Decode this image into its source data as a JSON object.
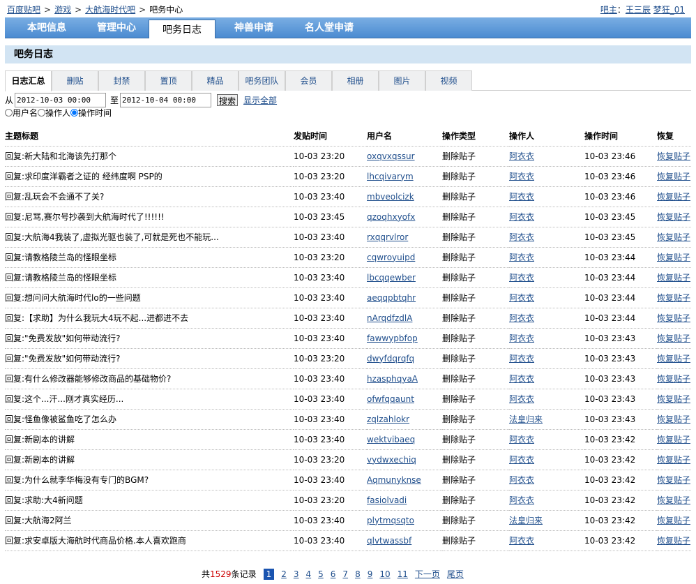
{
  "breadcrumb": [
    "百度贴吧",
    "游戏",
    "大航海时代吧"
  ],
  "breadcrumb_current": "吧务中心",
  "breadcrumb_sep": ">",
  "owner": {
    "label": "吧主",
    "sep": "：",
    "names": [
      "王三辰",
      "梦狂_01"
    ]
  },
  "nav": {
    "tabs": [
      "本吧信息",
      "管理中心",
      "吧务日志",
      "神兽申请",
      "名人堂申请"
    ],
    "active": 2
  },
  "section_title": "吧务日志",
  "subtabs": {
    "items": [
      "日志汇总",
      "删贴",
      "封禁",
      "置顶",
      "精品",
      "吧务团队",
      "会员",
      "相册",
      "图片",
      "视频"
    ],
    "active": 0
  },
  "filter": {
    "from_label": "从",
    "from_value": "2012-10-03 00:00",
    "to_label": "至",
    "to_value": "2012-10-04 00:00",
    "search_label": "搜索",
    "show_all": "显示全部"
  },
  "radios": {
    "options": [
      "用户名",
      "操作人",
      "操作时间"
    ],
    "selected": 2
  },
  "table": {
    "headers": [
      "主题标题",
      "发贴时间",
      "用户名",
      "操作类型",
      "操作人",
      "操作时间",
      "恢复"
    ],
    "rows": [
      [
        "回复:新大陆和北海该先打那个",
        "10-03 23:20",
        "oxqvxqssur",
        "删除贴子",
        "阿衣衣",
        "10-03 23:46",
        "恢复贴子"
      ],
      [
        "回复:求印度洋霸者之证的 经纬度啊 PSP的",
        "10-03 23:20",
        "lhcqivarym",
        "删除贴子",
        "阿衣衣",
        "10-03 23:46",
        "恢复贴子"
      ],
      [
        "回复:乱玩会不会通不了关?",
        "10-03 23:40",
        "mbveolcizk",
        "删除贴子",
        "阿衣衣",
        "10-03 23:46",
        "恢复贴子"
      ],
      [
        "回复:尼骂,赛尔号抄袭到大航海时代了!!!!!!",
        "10-03 23:45",
        "qzoqhxyofx",
        "删除贴子",
        "阿衣衣",
        "10-03 23:45",
        "恢复贴子"
      ],
      [
        "回复:大航海4我装了,虚拟光驱也装了,可就是死也不能玩...",
        "10-03 23:40",
        "rxqqrvlror",
        "删除贴子",
        "阿衣衣",
        "10-03 23:45",
        "恢复贴子"
      ],
      [
        "回复:请教格陵兰岛的怪眼坐标",
        "10-03 23:20",
        "cqwroyuipd",
        "删除贴子",
        "阿衣衣",
        "10-03 23:44",
        "恢复贴子"
      ],
      [
        "回复:请教格陵兰岛的怪眼坐标",
        "10-03 23:40",
        "lbcqqewber",
        "删除贴子",
        "阿衣衣",
        "10-03 23:44",
        "恢复贴子"
      ],
      [
        "回复:想问问大航海时代lo的一些问题",
        "10-03 23:40",
        "aeqqpbtqhr",
        "删除贴子",
        "阿衣衣",
        "10-03 23:44",
        "恢复贴子"
      ],
      [
        "回复:【求助】为什么我玩大4玩不起...进都进不去",
        "10-03 23:40",
        "nArqdfzdlA",
        "删除贴子",
        "阿衣衣",
        "10-03 23:44",
        "恢复贴子"
      ],
      [
        "回复:\"免费发放\"如何带动流行?",
        "10-03 23:40",
        "fawwypbfop",
        "删除贴子",
        "阿衣衣",
        "10-03 23:43",
        "恢复贴子"
      ],
      [
        "回复:\"免费发放\"如何带动流行?",
        "10-03 23:20",
        "dwyfdqrqfq",
        "删除贴子",
        "阿衣衣",
        "10-03 23:43",
        "恢复贴子"
      ],
      [
        "回复:有什么修改器能够修改商品的基础物价?",
        "10-03 23:40",
        "hzasphqyaA",
        "删除贴子",
        "阿衣衣",
        "10-03 23:43",
        "恢复贴子"
      ],
      [
        "回复:这个...汗...刚才真实经历...",
        "10-03 23:40",
        "ofwfqqaunt",
        "删除贴子",
        "阿衣衣",
        "10-03 23:43",
        "恢复贴子"
      ],
      [
        "回复:怪鱼像被鲨鱼吃了怎么办",
        "10-03 23:40",
        "zqlzahlokr",
        "删除贴子",
        "法皇归来",
        "10-03 23:43",
        "恢复贴子"
      ],
      [
        "回复:新剧本的讲解",
        "10-03 23:40",
        "wektvibaeq",
        "删除贴子",
        "阿衣衣",
        "10-03 23:42",
        "恢复贴子"
      ],
      [
        "回复:新剧本的讲解",
        "10-03 23:20",
        "vydwxechiq",
        "删除贴子",
        "阿衣衣",
        "10-03 23:42",
        "恢复贴子"
      ],
      [
        "回复:为什么就李华梅没有专门的BGM?",
        "10-03 23:40",
        "Aqmunyknse",
        "删除贴子",
        "阿衣衣",
        "10-03 23:42",
        "恢复贴子"
      ],
      [
        "回复:求助:大4新问题",
        "10-03 23:20",
        "fasiolvadi",
        "删除贴子",
        "阿衣衣",
        "10-03 23:42",
        "恢复贴子"
      ],
      [
        "回复:大航海2阿兰",
        "10-03 23:40",
        "plytmqsqto",
        "删除贴子",
        "法皇归来",
        "10-03 23:42",
        "恢复贴子"
      ],
      [
        "回复:求安卓版大海航时代商品价格.本人喜欢跑商",
        "10-03 23:40",
        "qlvtwassbf",
        "删除贴子",
        "阿衣衣",
        "10-03 23:42",
        "恢复贴子"
      ]
    ]
  },
  "pager": {
    "prefix": "共",
    "total": "1529",
    "suffix": "条记录",
    "pages": [
      "1",
      "2",
      "3",
      "4",
      "5",
      "6",
      "7",
      "8",
      "9",
      "10",
      "11"
    ],
    "current": "1",
    "next": "下一页",
    "last": "尾页"
  },
  "colors": {
    "nav_blue": "#4b8bd1",
    "section_bg": "#d2e4f3",
    "link": "#1f4e8c",
    "count_red": "#cc0000",
    "pager_current": "#1a54b0"
  }
}
